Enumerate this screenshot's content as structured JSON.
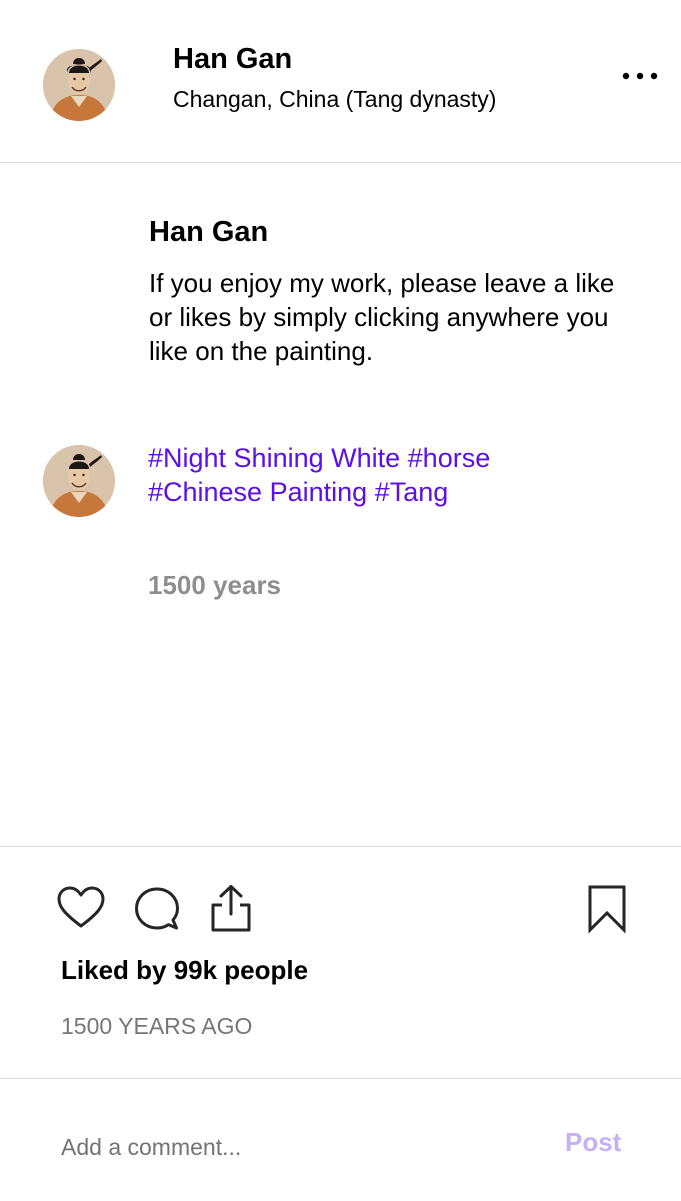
{
  "header": {
    "username": "Han Gan",
    "location": "Changan, China (Tang dynasty)",
    "more_icon": "more-horizontal-icon"
  },
  "caption": {
    "username": "Han Gan",
    "text": "If you enjoy my work, please leave a like or likes by simply clicking anywhere you like on the painting."
  },
  "comment": {
    "tags": [
      "#Night Shining White",
      "#horse",
      "#Chinese Painting",
      "#Tang"
    ],
    "age": "1500 years",
    "tag_color": "#5a10e6"
  },
  "actions": {
    "icons": [
      "heart-icon",
      "comment-bubble-icon",
      "share-icon",
      "bookmark-icon"
    ],
    "likes": "Liked by 99k people",
    "posted": "1500 YEARS AGO"
  },
  "comment_bar": {
    "placeholder": "Add a comment...",
    "post_label": "Post",
    "post_color": "#c4b0f5"
  }
}
